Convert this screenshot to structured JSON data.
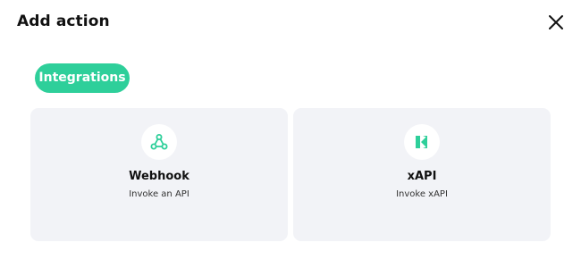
{
  "dialog": {
    "title": "Add action"
  },
  "tabs": [
    {
      "label": "Integrations",
      "active": true
    }
  ],
  "cards": [
    {
      "title": "Webhook",
      "description": "Invoke an API",
      "icon": "webhook-icon"
    },
    {
      "title": "xAPI",
      "description": "Invoke xAPI",
      "icon": "xapi-icon"
    }
  ],
  "colors": {
    "accent": "#2ecf9a",
    "card_bg": "#f2f3f7"
  }
}
